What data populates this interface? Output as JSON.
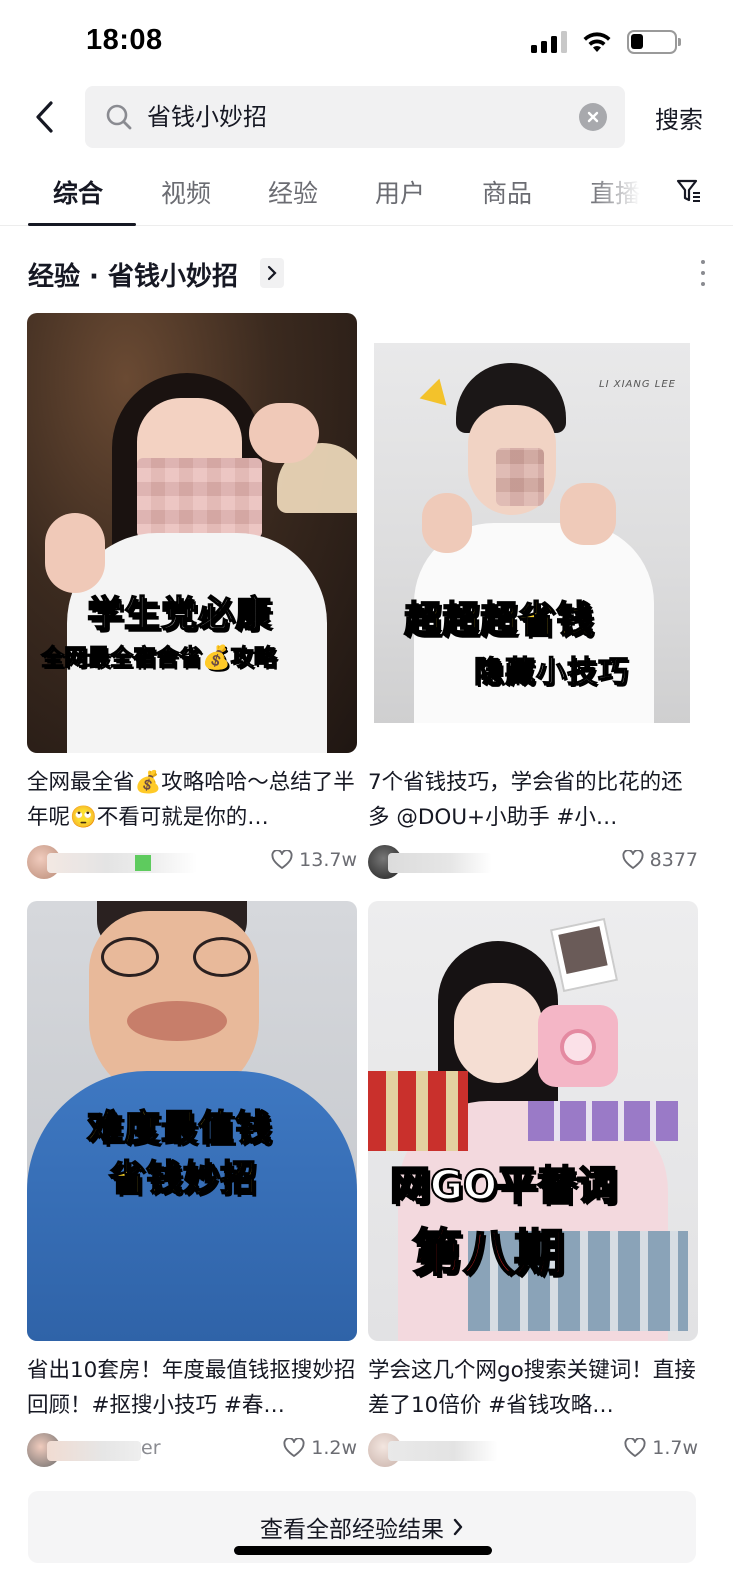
{
  "status_bar": {
    "time": "18:08",
    "battery_icon": "battery-low-icon",
    "signal_icon": "cellular-signal-icon",
    "wifi_icon": "wifi-icon"
  },
  "search": {
    "query": "省钱小妙招",
    "submit_label": "搜索",
    "back_icon": "chevron-left-icon",
    "clear_icon": "clear-circle-icon"
  },
  "tabs": [
    {
      "label": "综合",
      "active": true
    },
    {
      "label": "视频",
      "active": false
    },
    {
      "label": "经验",
      "active": false
    },
    {
      "label": "用户",
      "active": false
    },
    {
      "label": "商品",
      "active": false
    },
    {
      "label": "直播",
      "active": false
    }
  ],
  "section": {
    "title": "经验 · 省钱小妙招"
  },
  "cards": [
    {
      "title": "全网最全省💰攻略哈哈～总结了半年呢🙄不看可就是你的…",
      "likes": "13.7w",
      "author_visible": "",
      "overlay": {
        "line1": "学生党必康",
        "line2": "全网最全宿舍省💰攻略"
      }
    },
    {
      "title": "7个省钱技巧，学会省的比花的还多 @DOU+小助手 #小…",
      "likes": "8377",
      "author_visible": "",
      "overlay": {
        "line1": "超超超省钱",
        "line2": "隐藏小技巧",
        "watermark": "LI XIANG LEE"
      }
    },
    {
      "title": "省出10套房！年度最值钱抠搜妙招回顾！#抠搜小技巧 #春…",
      "likes": "1.2w",
      "author_visible": "er",
      "overlay": {
        "line1": "难度最值钱",
        "line2": "省钱妙招"
      }
    },
    {
      "title": "学会这几个网go搜索关键词！直接差了10倍价 #省钱攻略…",
      "likes": "1.7w",
      "author_visible": "",
      "overlay": {
        "line1": "网GO平替词",
        "line2": "第八期"
      }
    }
  ],
  "footer": {
    "view_all_label": "查看全部经验结果"
  },
  "colors": {
    "text_primary": "#161823",
    "text_secondary": "#6b6c72",
    "search_bg": "#f1f1f2",
    "caption_yellow": "#f7d12a",
    "caption_red": "#e02020"
  }
}
